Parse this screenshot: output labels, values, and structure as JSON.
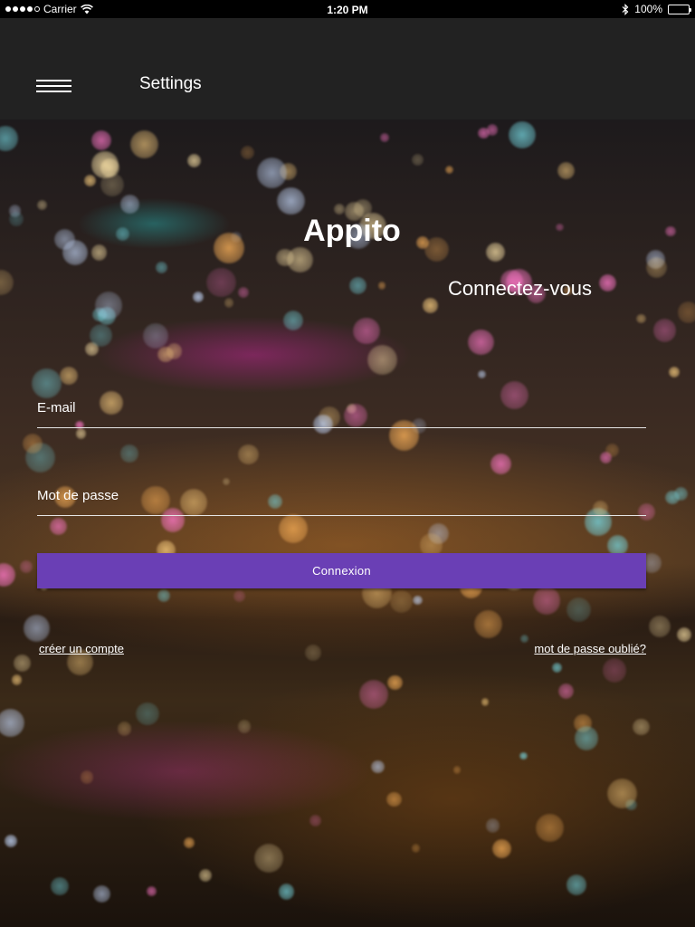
{
  "status_bar": {
    "carrier": "Carrier",
    "time": "1:20 PM",
    "battery_percent": "100%",
    "icons": [
      "signal-dots",
      "wifi-icon",
      "bluetooth-icon",
      "battery-icon"
    ]
  },
  "toolbar": {
    "title": "Settings",
    "menu_icon": "hamburger-menu-icon",
    "background_color": "#222222"
  },
  "login": {
    "app_name": "Appito",
    "subtitle": "Connectez-vous",
    "email_label": "E-mail",
    "email_value": "",
    "password_label": "Mot de passe",
    "password_value": "",
    "submit_label": "Connexion",
    "create_account_link": "créer un compte",
    "forgot_password_link": "mot de passe oublié?",
    "button_color": "#6a3fb5"
  }
}
